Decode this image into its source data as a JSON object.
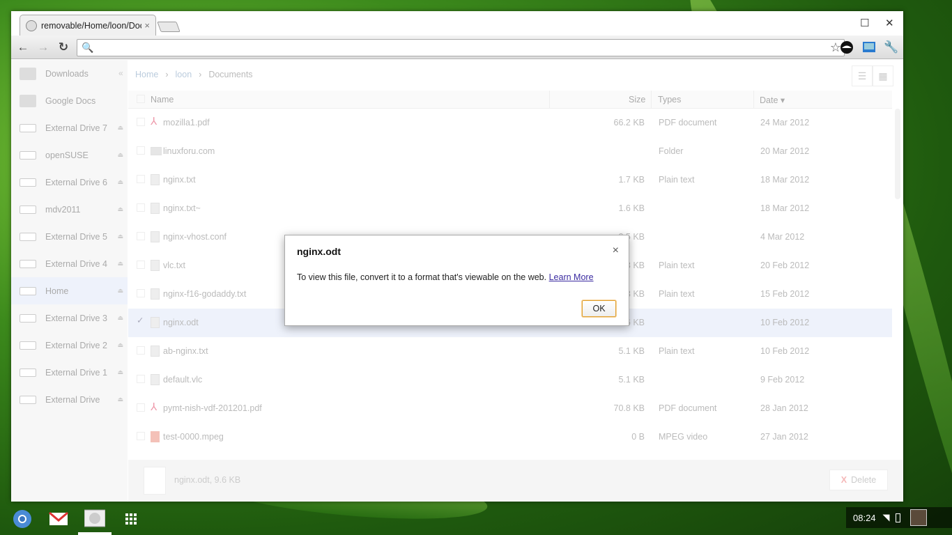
{
  "browser": {
    "tab_title": "removable/Home/loon/Documents",
    "tab_close": "×",
    "maximize_glyph": "☐",
    "close_glyph": "✕",
    "back_glyph": "←",
    "forward_glyph": "→",
    "reload_glyph": "↻",
    "search_glyph": "🔍",
    "star_glyph": "☆",
    "wrench_glyph": "🔧"
  },
  "file_manager": {
    "collapse_glyph": "«",
    "breadcrumb": [
      "Home",
      "loon",
      "Documents"
    ],
    "breadcrumb_sep": "›",
    "list_view_glyph": "☰",
    "grid_view_glyph": "▦",
    "sidebar": [
      {
        "label": "Downloads",
        "icon": "downloads-icon",
        "eject": false,
        "selected": false
      },
      {
        "label": "Google Docs",
        "icon": "folder-icon",
        "eject": false,
        "selected": false
      },
      {
        "label": "External Drive 7",
        "icon": "drive-icon",
        "eject": true,
        "selected": false
      },
      {
        "label": "openSUSE",
        "icon": "drive-icon",
        "eject": true,
        "selected": false
      },
      {
        "label": "External Drive 6",
        "icon": "drive-icon",
        "eject": true,
        "selected": false
      },
      {
        "label": "mdv2011",
        "icon": "drive-icon",
        "eject": true,
        "selected": false
      },
      {
        "label": "External Drive 5",
        "icon": "drive-icon",
        "eject": true,
        "selected": false
      },
      {
        "label": "External Drive 4",
        "icon": "drive-icon",
        "eject": true,
        "selected": false
      },
      {
        "label": "Home",
        "icon": "drive-icon",
        "eject": true,
        "selected": true
      },
      {
        "label": "External Drive 3",
        "icon": "drive-icon",
        "eject": true,
        "selected": false
      },
      {
        "label": "External Drive 2",
        "icon": "drive-icon",
        "eject": true,
        "selected": false
      },
      {
        "label": "External Drive 1",
        "icon": "drive-icon",
        "eject": true,
        "selected": false
      },
      {
        "label": "External Drive",
        "icon": "drive-icon",
        "eject": true,
        "selected": false
      }
    ],
    "eject_glyph": "⏏",
    "columns": [
      "Name",
      "Size",
      "Types",
      "Date ▾"
    ],
    "files": [
      {
        "name": "mozilla1.pdf",
        "size": "66.2 KB",
        "type": "PDF document",
        "date": "24 Mar 2012",
        "kind": "pdf",
        "selected": false
      },
      {
        "name": "linuxforu.com",
        "size": "",
        "type": "Folder",
        "date": "20 Mar 2012",
        "kind": "folder",
        "selected": false
      },
      {
        "name": "nginx.txt",
        "size": "1.7 KB",
        "type": "Plain text",
        "date": "18 Mar 2012",
        "kind": "file",
        "selected": false
      },
      {
        "name": "nginx.txt~",
        "size": "1.6 KB",
        "type": "",
        "date": "18 Mar 2012",
        "kind": "file",
        "selected": false
      },
      {
        "name": "nginx-vhost.conf",
        "size": "2.5 KB",
        "type": "",
        "date": "4 Mar 2012",
        "kind": "file",
        "selected": false
      },
      {
        "name": "vlc.txt",
        "size": "3.3 KB",
        "type": "Plain text",
        "date": "20 Feb 2012",
        "kind": "file",
        "selected": false
      },
      {
        "name": "nginx-f16-godaddy.txt",
        "size": "3.3 KB",
        "type": "Plain text",
        "date": "15 Feb 2012",
        "kind": "file",
        "selected": false
      },
      {
        "name": "nginx.odt",
        "size": "9.6 KB",
        "type": "",
        "date": "10 Feb 2012",
        "kind": "file",
        "selected": true
      },
      {
        "name": "ab-nginx.txt",
        "size": "5.1 KB",
        "type": "Plain text",
        "date": "10 Feb 2012",
        "kind": "file",
        "selected": false
      },
      {
        "name": "default.vlc",
        "size": "5.1 KB",
        "type": "",
        "date": "9 Feb 2012",
        "kind": "file",
        "selected": false
      },
      {
        "name": "pymt-nish-vdf-201201.pdf",
        "size": "70.8 KB",
        "type": "PDF document",
        "date": "28 Jan 2012",
        "kind": "pdf",
        "selected": false
      },
      {
        "name": "test-0000.mpeg",
        "size": "0 B",
        "type": "MPEG video",
        "date": "27 Jan 2012",
        "kind": "video",
        "selected": false
      }
    ],
    "check_glyph": "✓",
    "pdf_glyph": "⅄",
    "footer": {
      "info": "nginx.odt, 9.6 KB",
      "delete_glyph": "X",
      "delete_label": "Delete"
    }
  },
  "dialog": {
    "title": "nginx.odt",
    "close_glyph": "×",
    "message": "To view this file, convert it to a format that's viewable on the web. ",
    "link": "Learn More",
    "ok_label": "OK"
  },
  "tray": {
    "time": "08:24",
    "wifi_glyph": "◥"
  }
}
